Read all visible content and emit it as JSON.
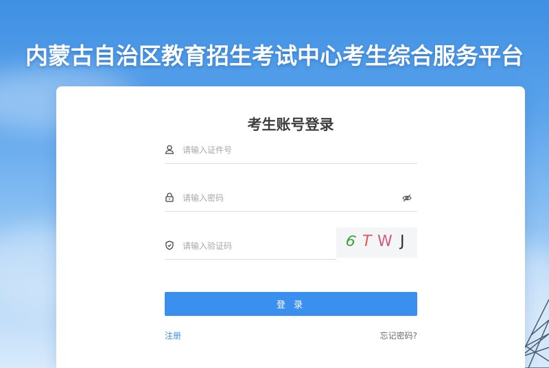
{
  "header": {
    "title": "内蒙古自治区教育招生考试中心考生综合服务平台"
  },
  "login": {
    "heading": "考生账号登录",
    "id_field": {
      "placeholder": "请输入证件号",
      "value": "",
      "icon": "user-icon"
    },
    "password_field": {
      "placeholder": "请输入密码",
      "value": "",
      "icon": "lock-icon",
      "toggle_icon": "eye-off-icon"
    },
    "captcha_field": {
      "placeholder": "请输入验证码",
      "value": "",
      "icon": "shield-check-icon"
    },
    "captcha_image": {
      "chars": [
        {
          "char": "6",
          "color": "#3aa53a"
        },
        {
          "char": "T",
          "color": "#e45555"
        },
        {
          "char": "W",
          "color": "#d05a7a"
        },
        {
          "char": "J",
          "color": "#2a2a2a"
        }
      ]
    },
    "submit_label": "登 录",
    "register_label": "注册",
    "forgot_label": "忘记密码?"
  },
  "colors": {
    "primary": "#3a8fef",
    "background_top": "#3f8fe3",
    "card": "#ffffff"
  }
}
